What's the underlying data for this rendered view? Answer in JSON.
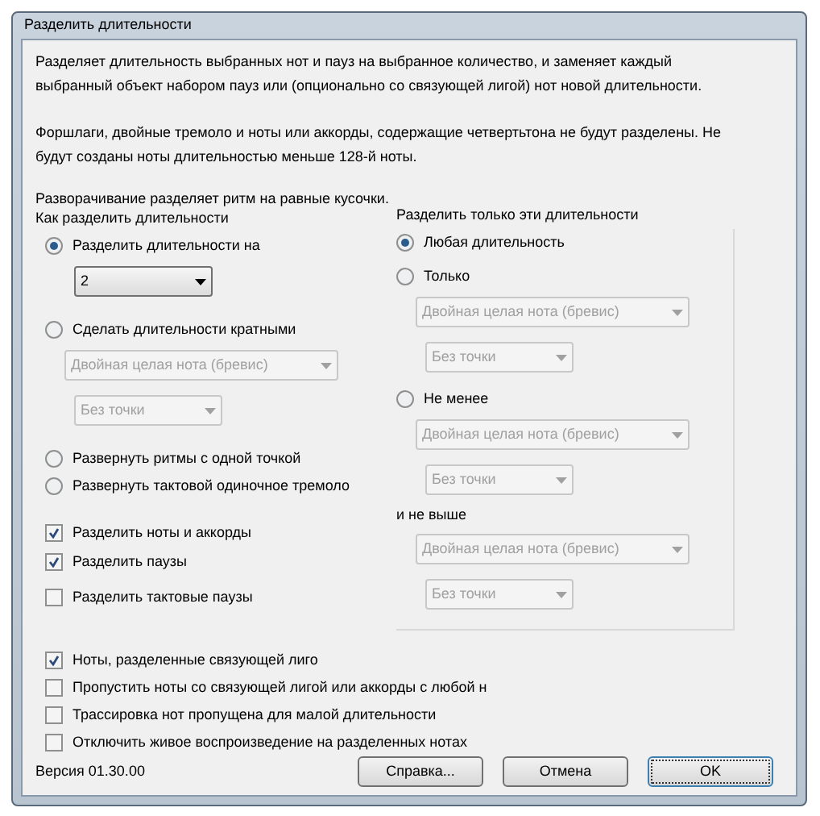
{
  "window": {
    "title": "Разделить длительности"
  },
  "description": [
    "Разделяет длительность выбранных нот и пауз на выбранное количество, и заменяет каждый выбранный объект набором пауз или (опционально со связующей лигой) нот новой длительности.",
    "Форшлаги, двойные тремоло и ноты или аккорды, содержащие четвертьтона не будут разделены. Не будут созданы ноты длительностью меньше 128-й ноты."
  ],
  "note": "Разворачивание разделяет ритм на равные кусочки.",
  "split_method": {
    "heading": "Как разделить длительности",
    "options": [
      {
        "label": "Разделить длительности на",
        "selected": true,
        "dropdowns": [
          {
            "value": "2",
            "disabled": false
          }
        ]
      },
      {
        "label": "Сделать длительности кратными",
        "selected": false,
        "dropdowns": [
          {
            "value": "Двойная целая нота (бревис)",
            "disabled": true
          },
          {
            "value": "Без точки",
            "disabled": true
          }
        ]
      },
      {
        "label": "Развернуть ритмы с одной точкой",
        "selected": false
      },
      {
        "label": "Развернуть тактовой одиночное тремоло",
        "selected": false
      }
    ]
  },
  "split_checks": [
    {
      "label": "Разделить ноты и аккорды",
      "checked": true
    },
    {
      "label": "Разделить паузы",
      "checked": true
    },
    {
      "label": "Разделить тактовые паузы",
      "checked": false
    }
  ],
  "filter": {
    "heading": "Разделить только эти длительности",
    "options": [
      {
        "label": "Любая длительность",
        "selected": true
      },
      {
        "label": "Только",
        "selected": false,
        "dropdowns": [
          {
            "value": "Двойная целая нота (бревис)",
            "disabled": true
          },
          {
            "value": "Без точки",
            "disabled": true
          }
        ]
      },
      {
        "label": "Не менее",
        "selected": false,
        "dropdowns": [
          {
            "value": "Двойная целая нота (бревис)",
            "disabled": true
          },
          {
            "value": "Без точки",
            "disabled": true
          }
        ]
      }
    ],
    "upper": {
      "label": "и не выше",
      "dropdowns": [
        {
          "value": "Двойная целая нота (бревис)",
          "disabled": true
        },
        {
          "value": "Без точки",
          "disabled": true
        }
      ]
    }
  },
  "tie_checks": [
    {
      "label": "Ноты, разделенные связующей лиго",
      "checked": true
    },
    {
      "label": "Пропустить ноты со связующей лигой или аккорды с любой н",
      "checked": false
    },
    {
      "label": "Трассировка нот пропущена для малой длительности",
      "checked": false
    },
    {
      "label": "Отключить живое воспроизведение на разделенных нотах",
      "checked": false
    }
  ],
  "version": "Версия 01.30.00",
  "buttons": [
    {
      "label": "Справка...",
      "default": false
    },
    {
      "label": "Отмена",
      "default": false
    },
    {
      "label": "OK",
      "default": true
    }
  ]
}
